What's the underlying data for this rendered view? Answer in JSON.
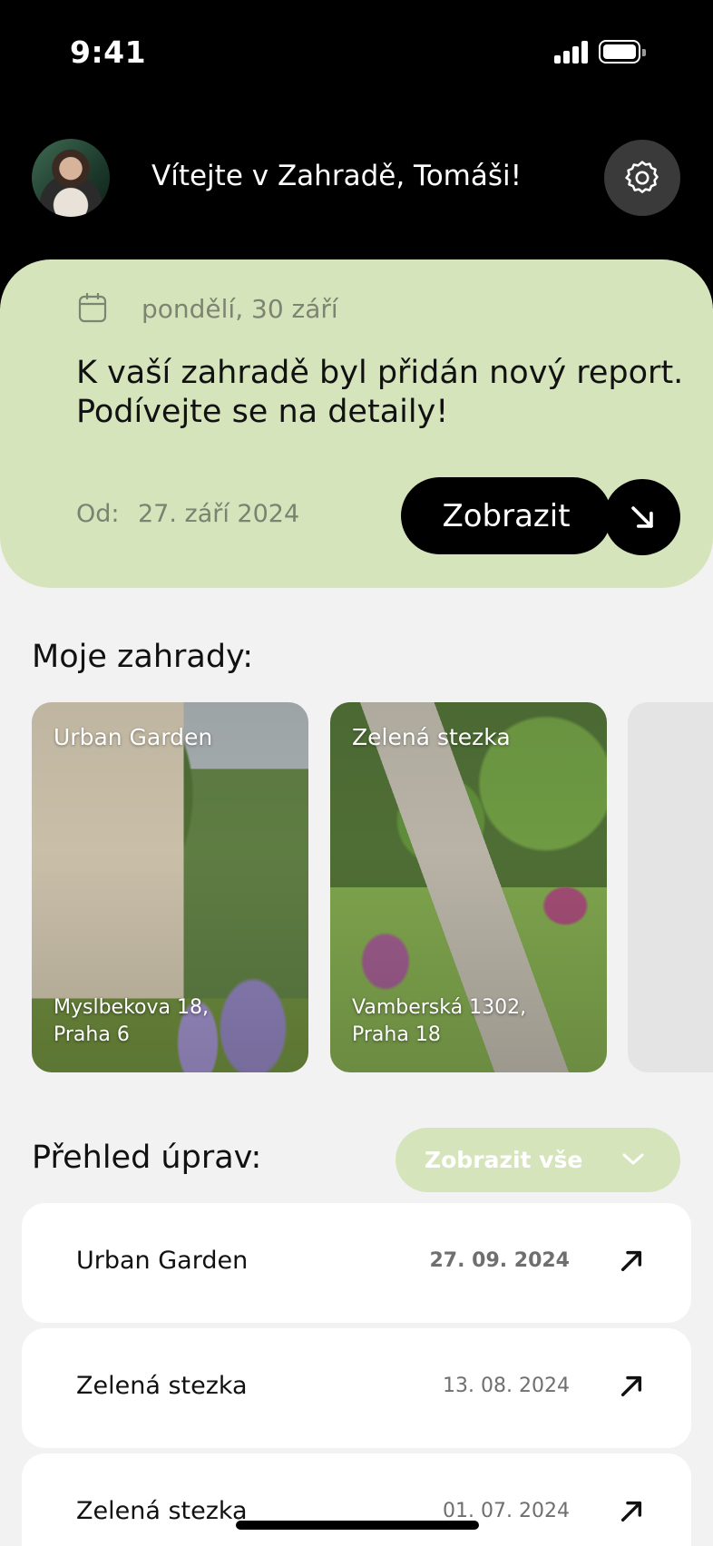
{
  "status_bar": {
    "time": "9:41"
  },
  "header": {
    "welcome": "Vítejte v Zahradě, Tomáši!",
    "avatar_icon": "user-avatar",
    "settings_icon": "gear-icon"
  },
  "report": {
    "date": "pondělí, 30 září",
    "message_line1": "K vaší zahradě byl přidán nový report.",
    "message_line2": "Podívejte se na detaily!",
    "from_label": "Od:",
    "from_value": "27. září 2024",
    "show_label": "Zobrazit"
  },
  "gardens": {
    "title": "Moje zahrady:",
    "items": [
      {
        "name": "Urban Garden",
        "address": "Myslbekova 18,\nPraha 6"
      },
      {
        "name": "Zelená stezka",
        "address": "Vamberská 1302,\nPraha 18"
      }
    ]
  },
  "edits": {
    "title": "Přehled úprav:",
    "filter_label": "Zobrazit vše",
    "rows": [
      {
        "name": "Urban Garden",
        "date": "27. 09. 2024"
      },
      {
        "name": "Zelená stezka",
        "date": "13. 08. 2024"
      },
      {
        "name": "Zelená stezka",
        "date": "01. 07. 2024"
      }
    ]
  },
  "colors": {
    "accent_green": "#d6e4bc",
    "background": "#f2f2f2",
    "header_bg": "#000000"
  }
}
